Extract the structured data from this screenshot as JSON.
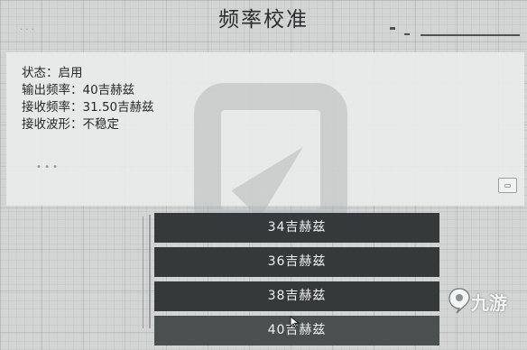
{
  "title": "频率校准",
  "status": [
    {
      "label": "状态：",
      "value": "启用"
    },
    {
      "label": "输出频率：",
      "value": "40吉赫兹"
    },
    {
      "label": "接收频率：",
      "value": "31.50吉赫兹"
    },
    {
      "label": "接收波形：",
      "value": "不稳定"
    }
  ],
  "frequency_options": [
    "34吉赫兹",
    "36吉赫兹",
    "38吉赫兹",
    "40吉赫兹"
  ],
  "corner_button_glyph": "▭",
  "watermark": {
    "logo_text": "九游"
  },
  "colors": {
    "button_bg": "#353939",
    "panel_bg": "#ebedec",
    "text": "#262929"
  }
}
